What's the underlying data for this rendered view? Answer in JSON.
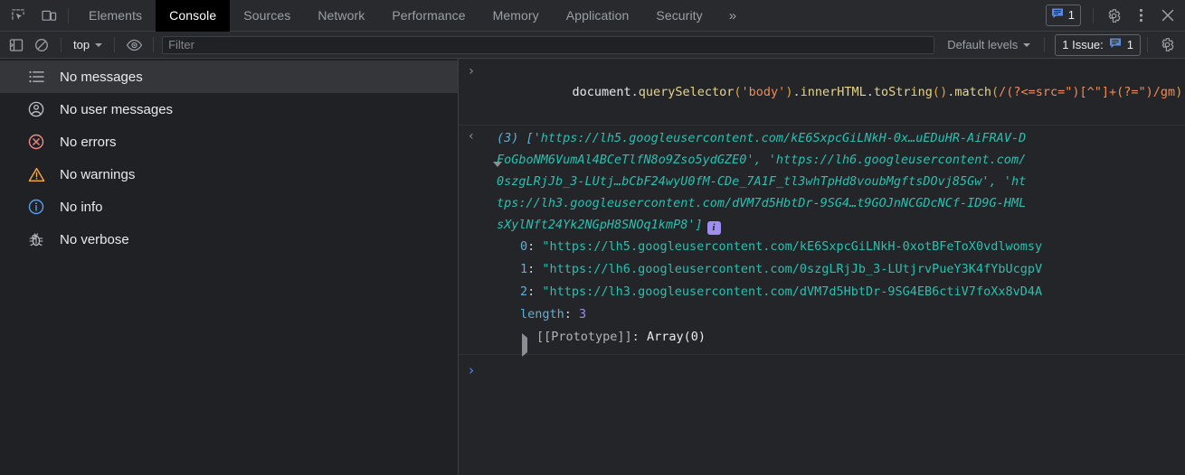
{
  "tabstrip": {
    "inspect_icon": "inspect-element-icon",
    "device_icon": "device-toolbar-icon",
    "tabs": [
      {
        "label": "Elements",
        "selected": false
      },
      {
        "label": "Console",
        "selected": true
      },
      {
        "label": "Sources",
        "selected": false
      },
      {
        "label": "Network",
        "selected": false
      },
      {
        "label": "Performance",
        "selected": false
      },
      {
        "label": "Memory",
        "selected": false
      },
      {
        "label": "Application",
        "selected": false
      },
      {
        "label": "Security",
        "selected": false
      }
    ],
    "more_tabs_label": "»",
    "issues_count": "1",
    "issues_icon": "issue-message-icon",
    "settings_icon": "gear-icon",
    "more_options_icon": "kebab-menu-icon",
    "close_icon": "close-icon"
  },
  "toolbar": {
    "sidebar_toggle_icon": "show-console-sidebar-icon",
    "clear_icon": "clear-console-icon",
    "context_label": "top",
    "eye_icon": "live-expression-icon",
    "filter_placeholder": "Filter",
    "filter_value": "",
    "levels_label": "Default levels",
    "issues_label": "1 Issue:",
    "issues_badge_icon": "issue-message-icon",
    "issues_number": "1",
    "settings_icon": "gear-icon"
  },
  "sidebar": {
    "items": [
      {
        "label": "No messages",
        "icon": "list-icon",
        "selected": true
      },
      {
        "label": "No user messages",
        "icon": "user-icon",
        "selected": false
      },
      {
        "label": "No errors",
        "icon": "error-circle-icon",
        "selected": false
      },
      {
        "label": "No warnings",
        "icon": "warning-triangle-icon",
        "selected": false
      },
      {
        "label": "No info",
        "icon": "info-circle-icon",
        "selected": false
      },
      {
        "label": "No verbose",
        "icon": "bug-icon",
        "selected": false
      }
    ]
  },
  "console": {
    "command": {
      "prompt_glyph": "›",
      "tokens": [
        {
          "t": "document",
          "c": "plain"
        },
        {
          "t": ".",
          "c": "punct"
        },
        {
          "t": "querySelector",
          "c": "prop"
        },
        {
          "t": "(",
          "c": "paren"
        },
        {
          "t": "'body'",
          "c": "str"
        },
        {
          "t": ")",
          "c": "paren"
        },
        {
          "t": ".",
          "c": "punct"
        },
        {
          "t": "innerHTML",
          "c": "prop"
        },
        {
          "t": ".",
          "c": "punct"
        },
        {
          "t": "toString",
          "c": "prop"
        },
        {
          "t": "(",
          "c": "paren"
        },
        {
          "t": ")",
          "c": "paren"
        },
        {
          "t": ".",
          "c": "punct"
        },
        {
          "t": "match",
          "c": "prop"
        },
        {
          "t": "(",
          "c": "paren"
        },
        {
          "t": "/(?<=src=\")[^\"]+(?=\")/gm",
          "c": "regex"
        },
        {
          "t": ")",
          "c": "paren"
        }
      ],
      "plain_text": "document.querySelector('body').innerHTML.toString().match(/(?<=src=\")[^\"]+(?=\")/gm)"
    },
    "result": {
      "return_glyph": "‹",
      "array_prefix": "(3) [",
      "preview_line1": "'https://lh5.googleusercontent.com/kE6SxpcGiLNkH-0x…uEDuHR-AiFRAV-D",
      "preview_line2": "FoGboNM6VumAl4BCeTlfN8o9Zso5ydGZE0', 'https://lh6.googleusercontent.com/",
      "preview_line3": "0szgLRjJb_3-LUtj…bCbF24wyU0fM-CDe_7A1F_tl3whTpHd8voubMgftsDOvj85Gw', 'ht",
      "preview_line4": "tps://lh3.googleusercontent.com/dVM7d5HbtDr-9SG4…t9GOJnNCGDcNCf-ID9G-HML",
      "preview_line5": "sXylNft24Yk2NGpH8SNOq1kmP8']",
      "info_badge": "i",
      "entries": [
        {
          "key": "0",
          "value": "\"https://lh5.googleusercontent.com/kE6SxpcGiLNkH-0xotBFeToX0vdlwomsy"
        },
        {
          "key": "1",
          "value": "\"https://lh6.googleusercontent.com/0szgLRjJb_3-LUtjrvPueY3K4fYbUcgpV"
        },
        {
          "key": "2",
          "value": "\"https://lh3.googleusercontent.com/dVM7d5HbtDr-9SG4EB6ctiV7foXx8vD4A"
        }
      ],
      "length_key": "length",
      "length_value": "3",
      "proto_key": "[[Prototype]]",
      "proto_value": "Array(0)"
    },
    "next_prompt_glyph": "›"
  },
  "colors": {
    "accent_blue": "#5a8ade",
    "string_teal": "#2bbfb0",
    "error_red": "#f28b82",
    "warning_orange": "#fbbc04",
    "info_blue": "#5db0d7",
    "badge_purple": "#9e8ef0"
  }
}
